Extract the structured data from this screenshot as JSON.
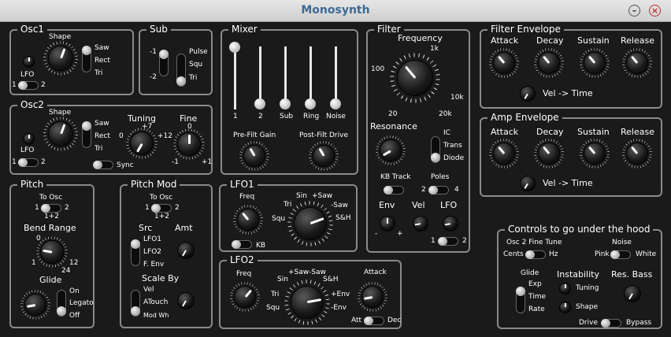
{
  "window": {
    "title": "Monosynth",
    "minimize_icon": "minimize-icon",
    "close_icon": "close-icon",
    "close_color": "#c03030"
  },
  "osc1": {
    "title": "Osc1",
    "shape": "Shape",
    "lfo": "LFO",
    "sw_1": "1",
    "sw_2": "2",
    "wave": [
      "Saw",
      "Rect",
      "Tri"
    ]
  },
  "sub": {
    "title": "Sub",
    "oct_up": "-1",
    "oct_down": "-2",
    "wave": [
      "Pulse",
      "Squ",
      "Tri"
    ]
  },
  "osc2": {
    "title": "Osc2",
    "shape": "Shape",
    "lfo": "LFO",
    "sw_1": "1",
    "sw_2": "2",
    "wave": [
      "Saw",
      "Rect",
      "Tri"
    ],
    "tuning": "Tuning",
    "tuning_plus7": "+7",
    "tuning_0": "0",
    "tuning_plus12": "+12",
    "fine": "Fine",
    "fine_0": "0",
    "fine_m1": "-1",
    "fine_p1": "+1",
    "sync": "Sync"
  },
  "mixer": {
    "title": "Mixer",
    "channels": [
      "1",
      "2",
      "Sub",
      "Ring",
      "Noise"
    ],
    "pre_gain": "Pre-Filt Gain",
    "post_drive": "Post-Filt Drive"
  },
  "filter": {
    "title": "Filter",
    "frequency": "Frequency",
    "f_1k": "1k",
    "f_100": "100",
    "f_10k": "10k",
    "f_20": "20",
    "f_20k": "20k",
    "resonance": "Resonance",
    "types": [
      "IC",
      "Trans",
      "Diode"
    ],
    "kb_track": "KB Track",
    "poles": "Poles",
    "poles_2": "2",
    "poles_4": "4",
    "env": "Env",
    "vel": "Vel",
    "lfo": "LFO",
    "env_minus": "-",
    "env_plus": "+",
    "lfo_1": "1",
    "lfo_2": "2"
  },
  "filter_env": {
    "title": "Filter Envelope",
    "knobs": [
      "Attack",
      "Decay",
      "Sustain",
      "Release"
    ],
    "vel_time": "Vel -> Time"
  },
  "amp_env": {
    "title": "Amp Envelope",
    "knobs": [
      "Attack",
      "Decay",
      "Sustain",
      "Release"
    ],
    "vel_time": "Vel -> Time"
  },
  "pitch": {
    "title": "Pitch",
    "to_osc": "To Osc",
    "o1": "1",
    "o2": "2",
    "o12": "1+2",
    "bend_range": "Bend Range",
    "b0": "0",
    "b1": "1",
    "b12": "12",
    "b24": "24",
    "glide": "Glide",
    "glide_modes": [
      "On",
      "Legato",
      "Off"
    ]
  },
  "pitch_mod": {
    "title": "Pitch Mod",
    "to_osc": "To Osc",
    "o1": "1",
    "o2": "2",
    "o12": "1+2",
    "src": "Src",
    "amt": "Amt",
    "sources": [
      "LFO1",
      "LFO2",
      "F. Env"
    ],
    "scale_by": "Scale By",
    "scales": [
      "Vel",
      "ATouch",
      "Mod Wh"
    ]
  },
  "lfo1": {
    "title": "LFO1",
    "freq": "Freq",
    "kb": "KB",
    "waves": {
      "tri": "Tri",
      "sin": "Sin",
      "psaw": "+Saw",
      "squ": "Squ",
      "msaw": "-Saw",
      "sh": "S&H"
    }
  },
  "lfo2": {
    "title": "LFO2",
    "freq": "Freq",
    "attack": "Attack",
    "att": "Att",
    "dec": "Dec",
    "waves": {
      "psaw": "+Saw",
      "msaw": "-Saw",
      "sin": "Sin",
      "sh": "S&H",
      "tri": "Tri",
      "penv": "+Env",
      "squ": "Squ",
      "menv": "-Env"
    }
  },
  "hood": {
    "title": "Controls to go under the hood",
    "fine_tune": "Osc 2 Fine Tune",
    "cents": "Cents",
    "hz": "Hz",
    "noise": "Noise",
    "pink": "Pink",
    "white": "White",
    "glide": "Glide",
    "glide_opts": [
      "Exp",
      "Time",
      "Rate"
    ],
    "instability": "Instability",
    "inst_opts": [
      "Tuning",
      "Shape"
    ],
    "res_bass": "Res. Bass",
    "drive": "Drive",
    "bypass": "Bypass"
  }
}
